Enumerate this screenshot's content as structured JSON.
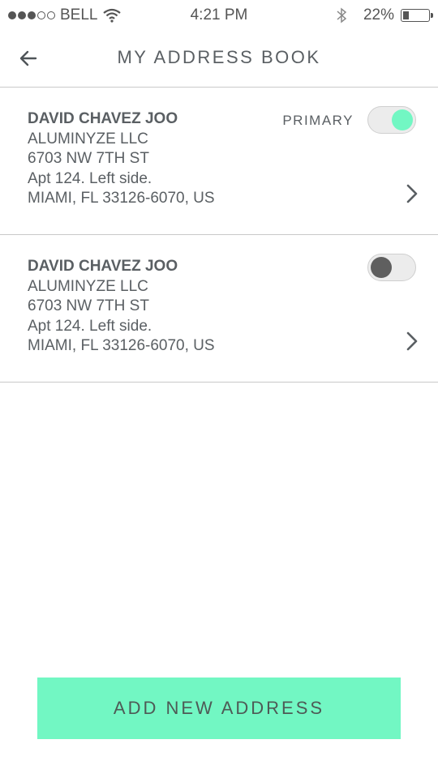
{
  "status_bar": {
    "carrier": "BELL",
    "signal_bars_filled": 3,
    "signal_bars_total": 5,
    "time": "4:21 PM",
    "battery_percent": "22%",
    "battery_level": 0.22
  },
  "nav": {
    "title": "MY ADDRESS BOOK",
    "back_icon": "arrow-left-icon"
  },
  "addresses": [
    {
      "name": "DAVID CHAVEZ JOO",
      "company": "ALUMINYZE LLC",
      "street": "6703 NW 7TH ST",
      "unit": "Apt 124. Left side.",
      "city_line": "MIAMI, FL 33126-6070, US",
      "primary_label": "PRIMARY",
      "primary": true
    },
    {
      "name": "DAVID CHAVEZ JOO",
      "company": "ALUMINYZE LLC",
      "street": "6703 NW 7TH ST",
      "unit": "Apt 124. Left side.",
      "city_line": "MIAMI, FL 33126-6070, US",
      "primary_label": "",
      "primary": false
    }
  ],
  "add_button": {
    "label": "ADD NEW ADDRESS"
  },
  "colors": {
    "accent": "#72f7c3",
    "text": "#5a5f63",
    "divider": "#c9c9c9",
    "toggle_off_knob": "#5f5f5f"
  }
}
